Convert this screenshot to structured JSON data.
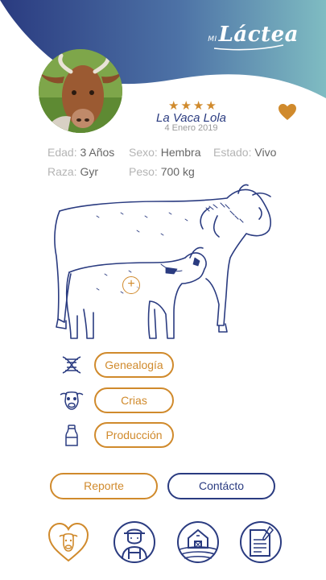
{
  "header": {
    "logo_prefix": "MI",
    "logo_name": "Láctea"
  },
  "profile": {
    "rating": 4,
    "star_glyph": "★",
    "name": "La Vaca Lola",
    "date": "4 Enero 2019",
    "favorite_icon": "heart-icon"
  },
  "attributes": {
    "edad_label": "Edad:",
    "edad_value": "3 Años",
    "sexo_label": "Sexo:",
    "sexo_value": "Hembra",
    "estado_label": "Estado:",
    "estado_value": "Vivo",
    "raza_label": "Raza:",
    "raza_value": "Gyr",
    "peso_label": "Peso:",
    "peso_value": "700 kg"
  },
  "illustration": {
    "add_symbol": "+"
  },
  "menu": {
    "genealogia": "Genealogía",
    "crias": "Crias",
    "produccion": "Producción"
  },
  "actions": {
    "reporte": "Reporte",
    "contacto": "Contácto"
  },
  "colors": {
    "primary": "#2a3b80",
    "accent": "#d08a2c",
    "gradient_end": "#7fbcc2"
  },
  "bottom_nav": {
    "icons": [
      "heart-cow-icon",
      "farmer-icon",
      "farm-barn-icon",
      "document-certificate-icon"
    ]
  }
}
